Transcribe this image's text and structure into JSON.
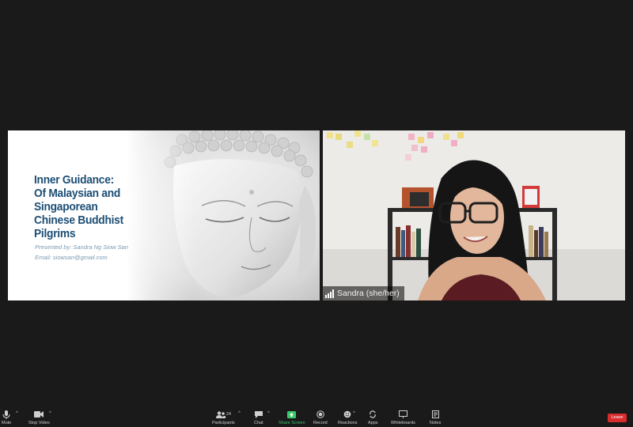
{
  "slide": {
    "title_lines": [
      "Inner Guidance:",
      "Of Malaysian and",
      "Singaporean",
      "Chinese Buddhist",
      "Pilgrims"
    ],
    "presenter": "Presented by: Sandra Ng Siow San",
    "email": "Email: siowsan@gmail.com"
  },
  "video": {
    "participant_name": "Sandra (she/her)"
  },
  "toolbar": {
    "mute": "Mute",
    "stop_video": "Stop Video",
    "participants": "Participants",
    "participants_count": "24",
    "chat": "Chat",
    "share_screen": "Share Screen",
    "record": "Record",
    "reactions": "Reactions",
    "apps": "Apps",
    "whiteboards": "Whiteboards",
    "notes": "Notes",
    "leave": "Leave"
  },
  "colors": {
    "background": "#1a1a1a",
    "slide_title": "#1d4f75",
    "share_green": "#3ec76a",
    "leave_red": "#d92d2d"
  }
}
